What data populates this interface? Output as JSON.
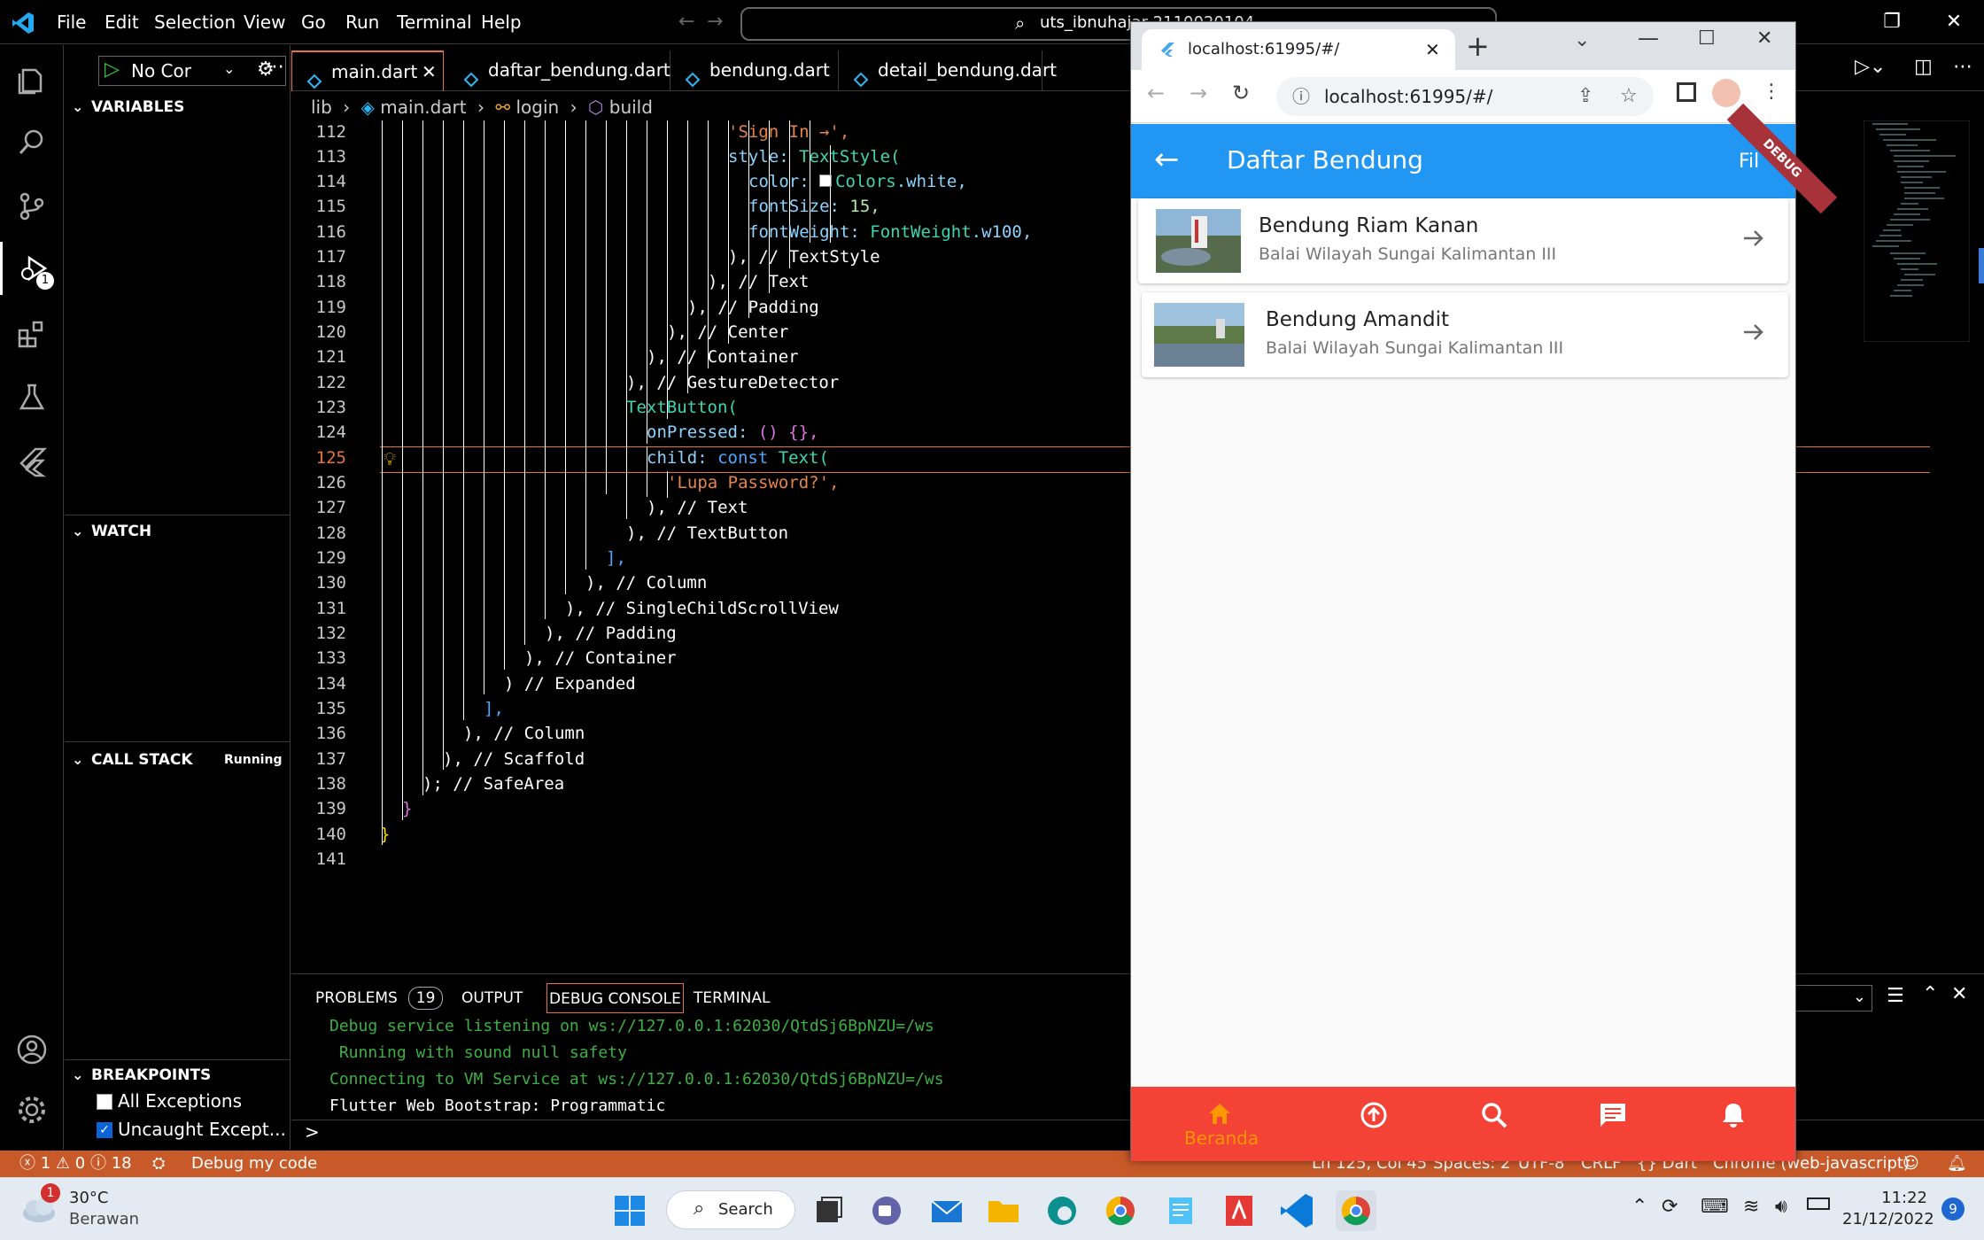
{
  "vscode": {
    "menu": [
      "File",
      "Edit",
      "Selection",
      "View",
      "Go",
      "Run",
      "Terminal",
      "Help"
    ],
    "command_center": "uts_ibnuhajar 2110020104",
    "run_config": "No Cor",
    "tabs": [
      {
        "label": "main.dart",
        "active": true
      },
      {
        "label": "daftar_bendung.dart",
        "active": false
      },
      {
        "label": "bendung.dart",
        "active": false
      },
      {
        "label": "detail_bendung.dart",
        "active": false
      }
    ],
    "breadcrumb": {
      "p1": "lib",
      "p2": "main.dart",
      "p3": "login",
      "p4": "build"
    },
    "sidebar": {
      "variables": "VARIABLES",
      "watch": "WATCH",
      "call_stack": "CALL STACK",
      "call_stack_status": "Running",
      "breakpoints": "BREAKPOINTS",
      "bp_all": "All Exceptions",
      "bp_uncaught": "Uncaught Except..."
    },
    "debug_badge": "1",
    "code": {
      "l112": "112",
      "c112": "'Sign In →',",
      "l113": "113",
      "c113a": "style: ",
      "c113b": "TextStyle(",
      "l114": "114",
      "c114a": "color: ",
      "c114b": "Colors",
      "c114c": ".white,",
      "l115": "115",
      "c115a": "fontSize: ",
      "c115b": "15,",
      "l116": "116",
      "c116a": "fontWeight: ",
      "c116b": "FontWeight",
      "c116c": ".w100,",
      "l117": "117",
      "c117": "), // TextStyle",
      "l118": "118",
      "c118": "), // Text",
      "l119": "119",
      "c119": "), // Padding",
      "l120": "120",
      "c120": "), // Center",
      "l121": "121",
      "c121": "), // Container",
      "l122": "122",
      "c122": "), // GestureDetector",
      "l123": "123",
      "c123": "TextButton(",
      "l124": "124",
      "c124a": "onPressed: ",
      "c124b": "() {},",
      "l125": "125",
      "c125a": "child: ",
      "c125b": "const ",
      "c125c": "Text(",
      "l126": "126",
      "c126": "'Lupa Password?',",
      "l127": "127",
      "c127": "), // Text",
      "l128": "128",
      "c128": "), // TextButton",
      "l129": "129",
      "c129": "],",
      "l130": "130",
      "c130": "), // Column",
      "l131": "131",
      "c131": "), // SingleChildScrollView",
      "l132": "132",
      "c132": "), // Padding",
      "l133": "133",
      "c133": "), // Container",
      "l134": "134",
      "c134": ") // Expanded",
      "l135": "135",
      "c135": "],",
      "l136": "136",
      "c136": "), // Column",
      "l137": "137",
      "c137": "), // Scaffold",
      "l138": "138",
      "c138": "); // SafeArea",
      "l139": "139",
      "c139": "}",
      "l140": "140",
      "c140": "}",
      "l141": "141"
    },
    "panel": {
      "problems": "PROBLEMS",
      "problems_count": "19",
      "output": "OUTPUT",
      "debug_console": "DEBUG CONSOLE",
      "terminal": "TERMINAL",
      "lines": [
        "Debug service listening on ws://127.0.0.1:62030/QtdSj6BpNZU=/ws",
        " Running with sound null safety",
        "Connecting to VM Service at ws://127.0.0.1:62030/QtdSj6BpNZU=/ws",
        "Flutter Web Bootstrap: Programmatic"
      ],
      "prompt": ">"
    },
    "status": {
      "errors": "1",
      "warnings": "0",
      "infos": "18",
      "debug": "Debug my code",
      "position": "Ln 125, Col 45",
      "spaces": "Spaces: 2",
      "encoding": "UTF-8",
      "eol": "CRLF",
      "language": "{} Dart",
      "target": "Chrome (web-javascript)"
    }
  },
  "chrome": {
    "tab_title": "localhost:61995/#/",
    "url": "localhost:61995/#/",
    "app": {
      "title": "Daftar Bendung",
      "action": "Fil",
      "debug_banner": "DEBUG",
      "items": [
        {
          "title": "Bendung Riam Kanan",
          "subtitle": "Balai Wilayah Sungai Kalimantan III"
        },
        {
          "title": "Bendung Amandit",
          "subtitle": "Balai Wilayah Sungai Kalimantan III"
        }
      ],
      "nav_active": "Beranda"
    }
  },
  "taskbar": {
    "weather_temp": "30°C",
    "weather_desc": "Berawan",
    "weather_badge": "1",
    "search": "Search",
    "time": "11:22",
    "date": "21/12/2022",
    "notif": "9"
  },
  "colors": {
    "accent": "#2196f3",
    "nav": "#f44336",
    "status": "#c85a2a",
    "nav_active": "#ff9800"
  }
}
